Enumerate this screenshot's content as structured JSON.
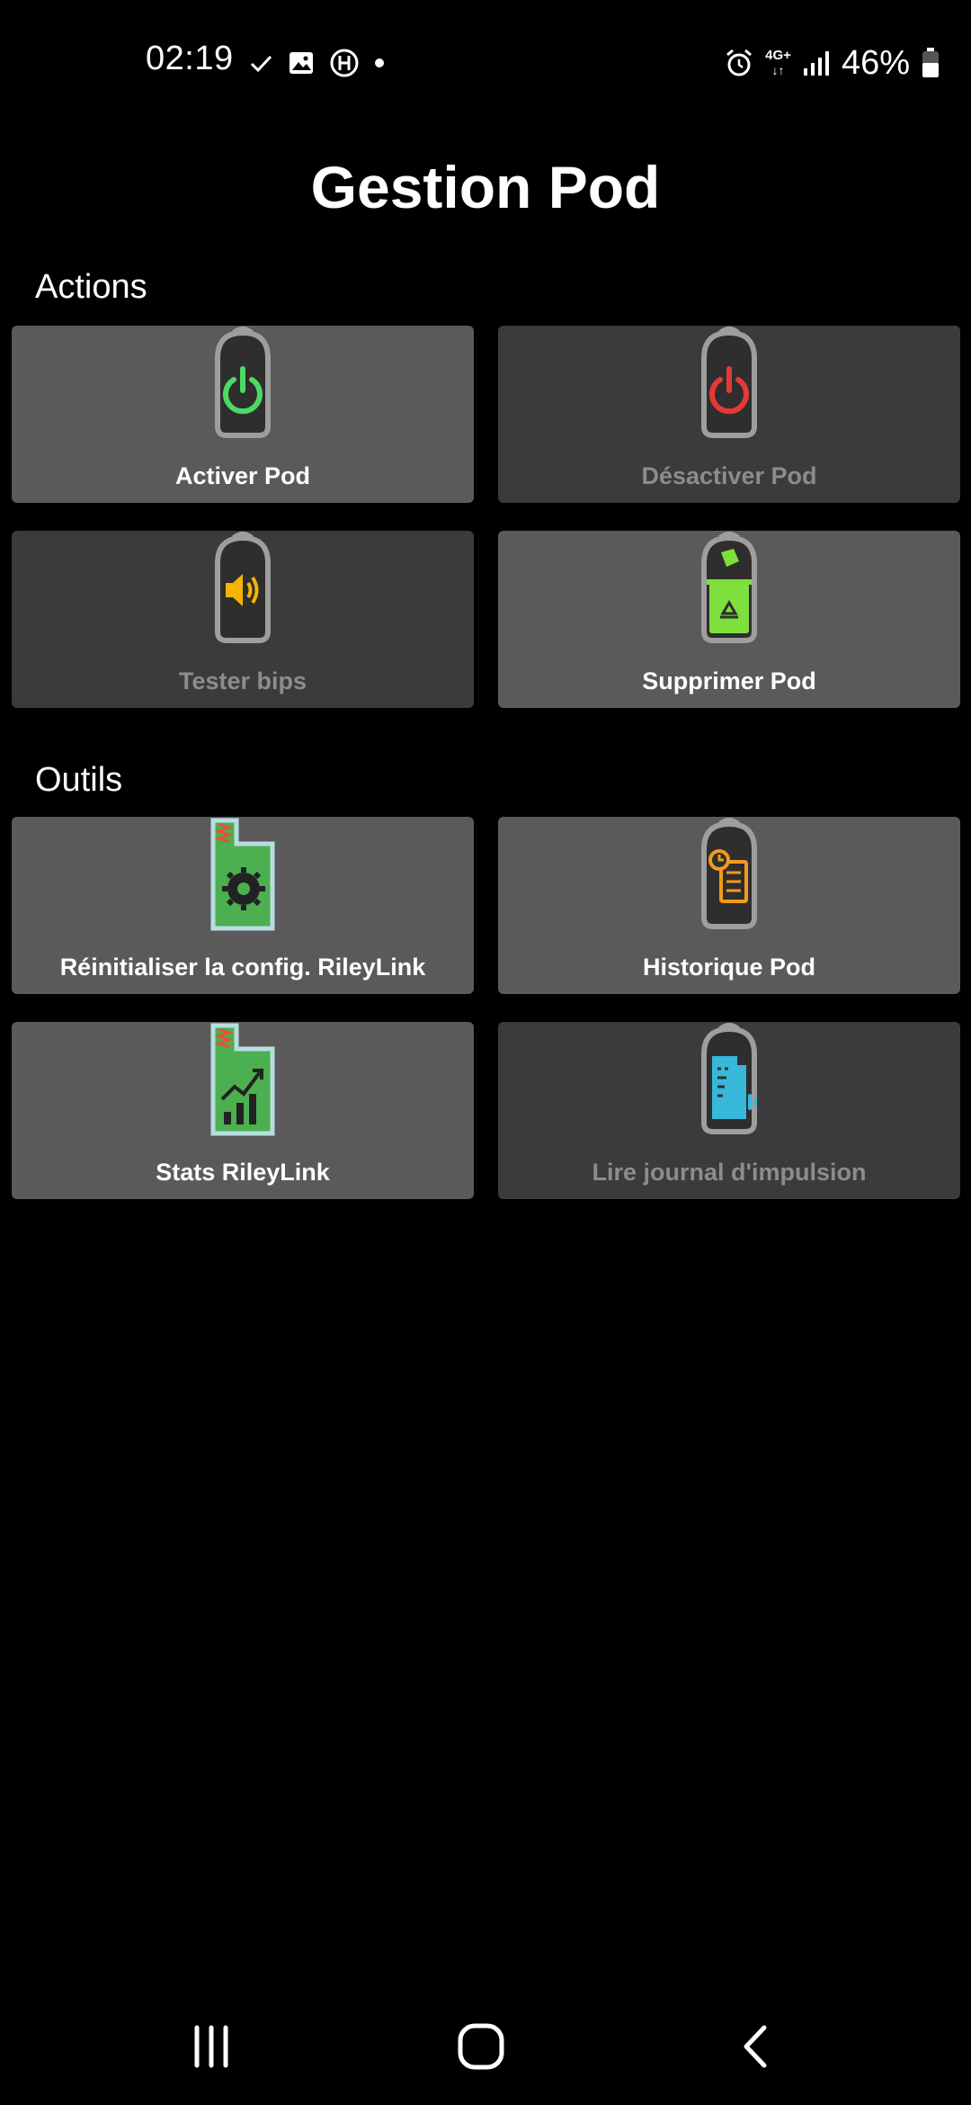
{
  "status_bar": {
    "time": "02:19",
    "network": "4G+",
    "battery": "46%",
    "icons_left": [
      "check-icon",
      "image-icon",
      "sync-icon",
      "dot-icon"
    ],
    "icons_right": [
      "alarm-icon",
      "network-4g-icon",
      "signal-icon",
      "battery-icon"
    ]
  },
  "page": {
    "title": "Gestion Pod"
  },
  "sections": {
    "actions": {
      "label": "Actions",
      "items": [
        {
          "label": "Activer Pod",
          "icon": "power-on-icon",
          "enabled": true,
          "accent": "#4cd964"
        },
        {
          "label": "Désactiver Pod",
          "icon": "power-off-icon",
          "enabled": false,
          "accent": "#e53935"
        },
        {
          "label": "Tester bips",
          "icon": "speaker-icon",
          "enabled": false,
          "accent": "#f5b400"
        },
        {
          "label": "Supprimer Pod",
          "icon": "recycle-bin-icon",
          "enabled": true,
          "accent": "#7ee03c"
        }
      ]
    },
    "tools": {
      "label": "Outils",
      "items": [
        {
          "label": "Réinitialiser la config. RileyLink",
          "icon": "rileylink-reset-icon",
          "enabled": true,
          "accent": "#4caf50"
        },
        {
          "label": "Historique Pod",
          "icon": "pod-history-icon",
          "enabled": true,
          "accent": "#f29a1e"
        },
        {
          "label": "Stats RileyLink",
          "icon": "rileylink-stats-icon",
          "enabled": true,
          "accent": "#4caf50"
        },
        {
          "label": "Lire journal d'impulsion",
          "icon": "pulse-log-icon",
          "enabled": false,
          "accent": "#37b8d9"
        }
      ]
    }
  },
  "colors": {
    "background": "#000000",
    "tile_enabled": "#5a5a5a",
    "tile_disabled": "#3b3b3b",
    "label_disabled": "#8c8c8c",
    "pod_outline": "#9e9e9e"
  },
  "navbar": {
    "buttons": [
      "recents-icon",
      "home-icon",
      "back-icon"
    ]
  }
}
